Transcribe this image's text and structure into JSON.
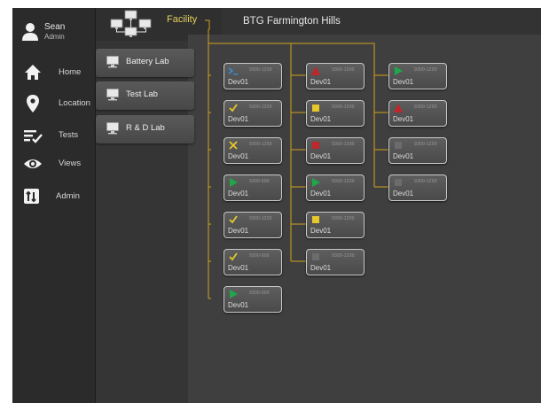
{
  "user": {
    "name": "Sean",
    "role": "Admin"
  },
  "nav": {
    "items": [
      {
        "label": "Home",
        "icon": "home-icon"
      },
      {
        "label": "Location",
        "icon": "location-pin-icon"
      },
      {
        "label": "Tests",
        "icon": "tests-icon"
      },
      {
        "label": "Views",
        "icon": "eye-icon"
      },
      {
        "label": "Admin",
        "icon": "admin-icon"
      }
    ]
  },
  "labs": [
    {
      "label": "Battery Lab"
    },
    {
      "label": "Test Lab"
    },
    {
      "label": "R & D Lab"
    }
  ],
  "header": {
    "facility_label": "Facility",
    "site_title": "BTG Farmington Hills"
  },
  "colors": {
    "accent_line": "#d1a21d",
    "facility_text": "#e2d25c",
    "status_green": "#1fa84a",
    "status_yellow": "#e6c82a",
    "status_red": "#c0262c",
    "status_gray": "#6c6c6c",
    "status_terminal": "#3a8fd6"
  },
  "devices": {
    "col1": [
      {
        "name": "Dev01",
        "range": "9300-1200",
        "status": "terminal"
      },
      {
        "name": "Dev01",
        "range": "9300-1200",
        "status": "check"
      },
      {
        "name": "Dev01",
        "range": "9300-1200",
        "status": "x"
      },
      {
        "name": "Dev01",
        "range": "9300-600",
        "status": "play"
      },
      {
        "name": "Dev01",
        "range": "9300-1200",
        "status": "check"
      },
      {
        "name": "Dev01",
        "range": "9300-900",
        "status": "check"
      },
      {
        "name": "Dev01",
        "range": "9300-000",
        "status": "play"
      }
    ],
    "col2": [
      {
        "name": "Dev01",
        "range": "9300-1200",
        "status": "warning"
      },
      {
        "name": "Dev01",
        "range": "9300-1200",
        "status": "yellow-square"
      },
      {
        "name": "Dev01",
        "range": "9300-1200",
        "status": "red-square"
      },
      {
        "name": "Dev01",
        "range": "9300-1200",
        "status": "play"
      },
      {
        "name": "Dev01",
        "range": "9300-1200",
        "status": "yellow-square"
      },
      {
        "name": "Dev01",
        "range": "9300-1200",
        "status": "gray-square"
      }
    ],
    "col3": [
      {
        "name": "Dev01",
        "range": "9300-1200",
        "status": "play"
      },
      {
        "name": "Dev01",
        "range": "9300-1200",
        "status": "warning"
      },
      {
        "name": "Dev01",
        "range": "9300-1200",
        "status": "gray-square"
      },
      {
        "name": "Dev01",
        "range": "9300-1200",
        "status": "gray-square"
      }
    ]
  }
}
